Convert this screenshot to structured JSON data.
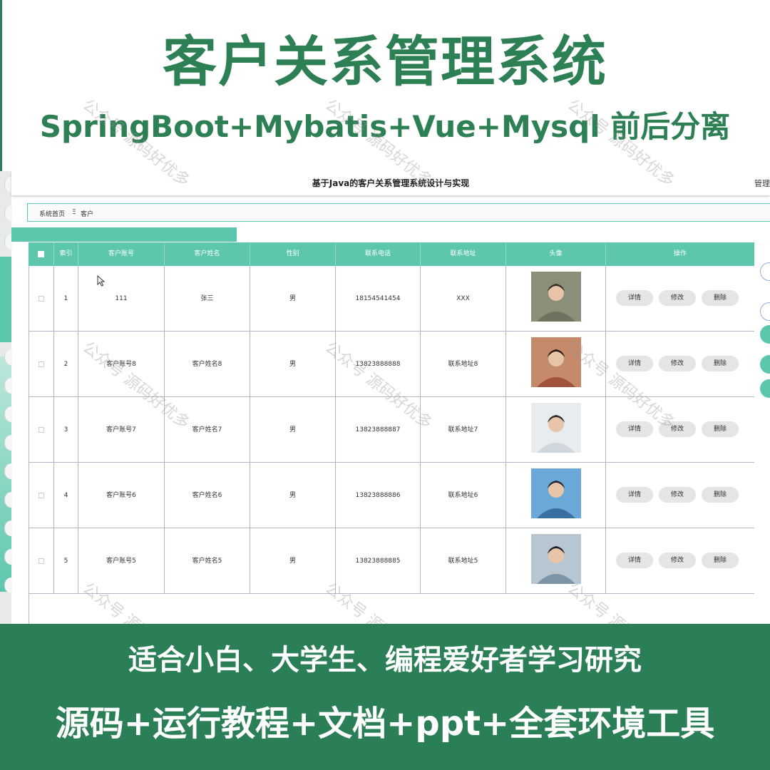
{
  "hero": {
    "title": "客户关系管理系统",
    "subtitle": "SpringBoot+Mybatis+Vue+Mysql 前后分离"
  },
  "app": {
    "title": "基于Java的客户关系管理系统设计与实现",
    "top_right": "管理",
    "breadcrumb": {
      "home": "系统首页",
      "separator": "Ξ",
      "current": "客户"
    }
  },
  "table": {
    "columns": [
      "索引",
      "客户账号",
      "客户姓名",
      "性别",
      "联系电话",
      "联系地址",
      "头像",
      "操作"
    ],
    "rows": [
      {
        "index": "1",
        "account": "111",
        "name": "张三",
        "gender": "男",
        "phone": "18154541454",
        "address": "XXX"
      },
      {
        "index": "2",
        "account": "客户账号8",
        "name": "客户姓名8",
        "gender": "男",
        "phone": "13823888888",
        "address": "联系地址8"
      },
      {
        "index": "3",
        "account": "客户账号7",
        "name": "客户姓名7",
        "gender": "男",
        "phone": "13823888887",
        "address": "联系地址7"
      },
      {
        "index": "4",
        "account": "客户账号6",
        "name": "客户姓名6",
        "gender": "男",
        "phone": "13823888886",
        "address": "联系地址6"
      },
      {
        "index": "5",
        "account": "客户账号5",
        "name": "客户姓名5",
        "gender": "男",
        "phone": "13823888885",
        "address": "联系地址5"
      }
    ],
    "actions": {
      "detail": "详情",
      "edit": "修改",
      "delete": "删除"
    }
  },
  "watermark": "公众号 源码好优多",
  "banner": {
    "line1": "适合小白、大学生、编程爱好者学习研究",
    "line2": "源码+运行教程+文档+ppt+全套环境工具"
  },
  "colors": {
    "brand_green": "#2d7f54",
    "table_teal": "#5cc7ad",
    "button_gray": "#e5e5e5"
  }
}
